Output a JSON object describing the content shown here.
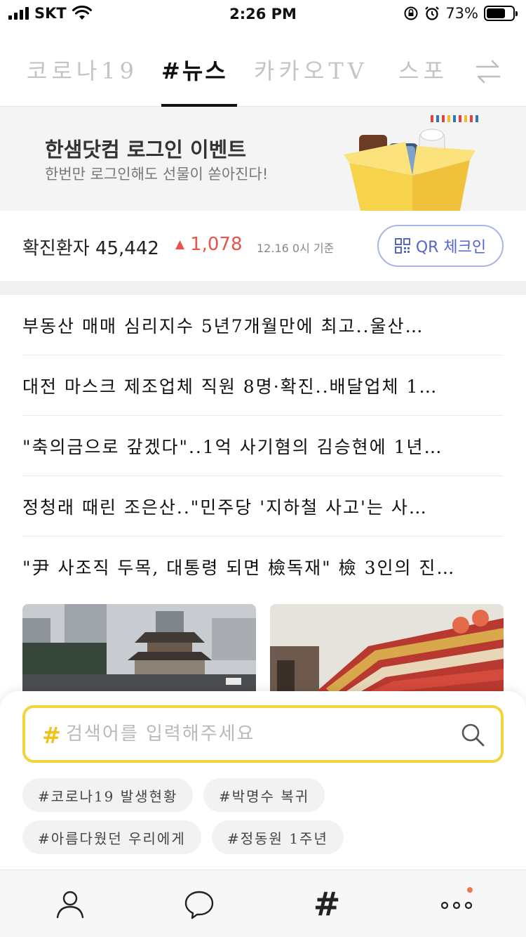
{
  "status_bar": {
    "carrier": "SKT",
    "time": "2:26 PM",
    "battery_percent": "73%",
    "battery_level": 0.73
  },
  "tabs": [
    {
      "label": "코로나19",
      "active": false
    },
    {
      "label": "#뉴스",
      "active": true
    },
    {
      "label": "카카오TV",
      "active": false
    },
    {
      "label": "스포",
      "active": false
    }
  ],
  "banner": {
    "title": "한샘닷컴 로그인 이벤트",
    "subtitle": "한번만 로그인해도 선물이 쏟아진다!"
  },
  "corona": {
    "label": "확진환자",
    "count": "45,442",
    "delta": "1,078",
    "date": "12.16 0시 기준",
    "qr_button": "QR 체크인"
  },
  "headlines": [
    "부동산 매매 심리지수 5년7개월만에 최고..울산…",
    "대전 마스크 제조업체 직원 8명·확진..배달업체 1…",
    "\"축의금으로 갚겠다\"..1억 사기혐의 김승현에 1년…",
    "정청래 때린 조은산..\"민주당 '지하철 사고'는 사…",
    "\"尹 사조직 두목, 대통령 되면 檢독재\" 檢 3인의 진…"
  ],
  "search": {
    "hash": "#",
    "placeholder": "검색어를 입력해주세요"
  },
  "chips": [
    "#코로나19 발생현황",
    "#박명수 복귀",
    "#아름다웠던 우리에게",
    "#정동원 1주년"
  ],
  "bottom_nav": {
    "hash_label": "#",
    "items": [
      "profile-icon",
      "chat-icon",
      "hash-icon",
      "more-icon"
    ]
  },
  "colors": {
    "accent_yellow": "#f2d43d",
    "delta_red": "#e8534a",
    "qr_blue": "#5566c8"
  }
}
